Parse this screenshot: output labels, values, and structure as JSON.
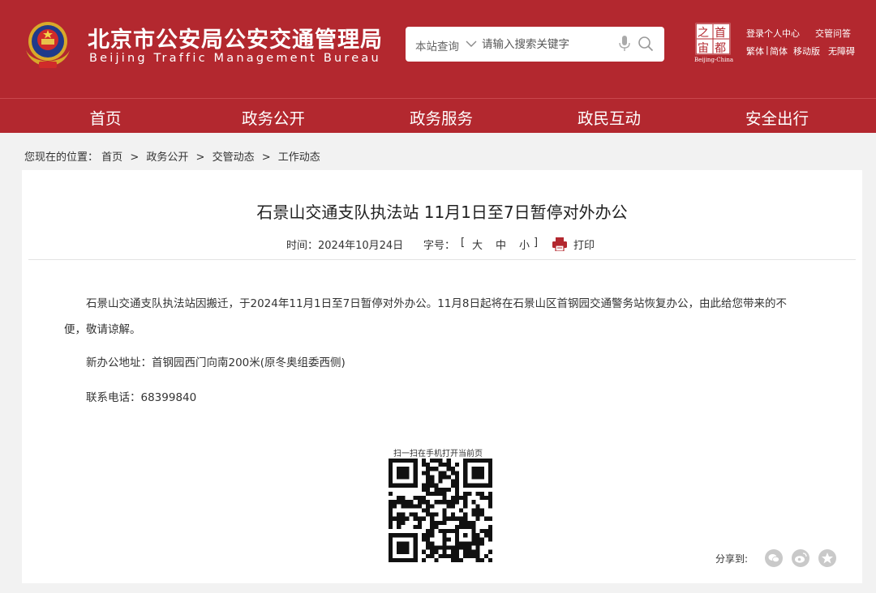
{
  "header": {
    "title_cn": "北京市公安局公安交通管理局",
    "title_en": "Beijing Traffic Management Bureau",
    "search": {
      "scope": "本站查询",
      "placeholder": "请输入搜索关键字"
    },
    "capital_logo": {
      "chars": [
        "之",
        "首",
        "宙",
        "都"
      ],
      "caption": "Beijing-China"
    },
    "links": {
      "login": "登录个人中心",
      "qa": "交管问答",
      "traditional": "繁体",
      "separator": "|",
      "simplified": "简体",
      "mobile": "移动版",
      "accessible": "无障碍"
    }
  },
  "nav": {
    "items": [
      {
        "label": "首页"
      },
      {
        "label": "政务公开"
      },
      {
        "label": "政务服务"
      },
      {
        "label": "政民互动"
      },
      {
        "label": "安全出行"
      }
    ]
  },
  "breadcrumb": {
    "prefix": "您现在的位置：",
    "items": [
      "首页",
      "政务公开",
      "交管动态",
      "工作动态"
    ],
    "separator": ">"
  },
  "article": {
    "title": "石景山交通支队执法站 11月1日至7日暂停对外办公",
    "date": "时间：2024年10月24日",
    "size_label": "字号：",
    "size_open": "[",
    "size_options": [
      "大",
      "中",
      "小"
    ],
    "size_close": "]",
    "print": "打印",
    "paragraph1_line1": "石景山交通支队执法站因搬迁，于2024年11月1日至7日暂停对外办公。11月8日起将在石景山区首钢园交通警务站恢复办公，由此给您带来的不",
    "paragraph1_line2": "便，敬请谅解。",
    "address": "新办公地址：首钢园西门向南200米(原冬奥组委西侧)",
    "phone": "联系电话：68399840"
  },
  "qr": {
    "caption": "扫一扫在手机打开当前页"
  },
  "share": {
    "label": "分享到:",
    "targets": [
      "wechat-icon",
      "weibo-icon",
      "qzone-icon"
    ]
  },
  "colors": {
    "brand_red": "#b3282f",
    "background": "#f2f2f2",
    "card": "#ffffff",
    "share_gray": "#c9c9c9"
  }
}
